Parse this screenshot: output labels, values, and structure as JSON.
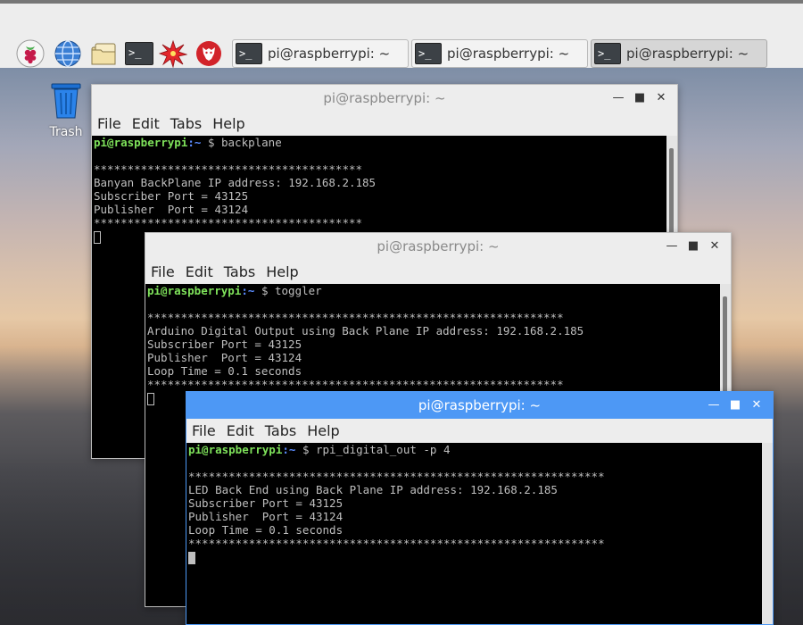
{
  "taskbar": {
    "tasks": [
      {
        "label": "pi@raspberrypi: ~",
        "active": false
      },
      {
        "label": "pi@raspberrypi: ~",
        "active": false
      },
      {
        "label": "pi@raspberrypi: ~",
        "active": true
      }
    ],
    "terminal_glyph": ">_"
  },
  "desktop": {
    "trash_label": "Trash"
  },
  "windows": [
    {
      "title": "pi@raspberrypi: ~",
      "menu": [
        "File",
        "Edit",
        "Tabs",
        "Help"
      ],
      "prompt_user": "pi@raspberrypi",
      "prompt_path": ":~",
      "prompt_sign": " $ ",
      "command": "backplane",
      "lines": [
        "",
        "****************************************",
        "Banyan BackPlane IP address: 192.168.2.185",
        "Subscriber Port = 43125",
        "Publisher  Port = 43124",
        "****************************************"
      ]
    },
    {
      "title": "pi@raspberrypi: ~",
      "menu": [
        "File",
        "Edit",
        "Tabs",
        "Help"
      ],
      "prompt_user": "pi@raspberrypi",
      "prompt_path": ":~",
      "prompt_sign": " $ ",
      "command": "toggler",
      "lines": [
        "",
        "**************************************************************",
        "Arduino Digital Output using Back Plane IP address: 192.168.2.185",
        "Subscriber Port = 43125",
        "Publisher  Port = 43124",
        "Loop Time = 0.1 seconds",
        "**************************************************************"
      ]
    },
    {
      "title": "pi@raspberrypi: ~",
      "menu": [
        "File",
        "Edit",
        "Tabs",
        "Help"
      ],
      "prompt_user": "pi@raspberrypi",
      "prompt_path": ":~",
      "prompt_sign": " $ ",
      "command": "rpi_digital_out -p 4",
      "lines": [
        "",
        "**************************************************************",
        "LED Back End using Back Plane IP address: 192.168.2.185",
        "Subscriber Port = 43125",
        "Publisher  Port = 43124",
        "Loop Time = 0.1 seconds",
        "**************************************************************"
      ]
    }
  ],
  "colors": {
    "prompt_user": "#7ee15a",
    "prompt_path": "#5b8cff",
    "focused_titlebar": "#4d98f5"
  }
}
